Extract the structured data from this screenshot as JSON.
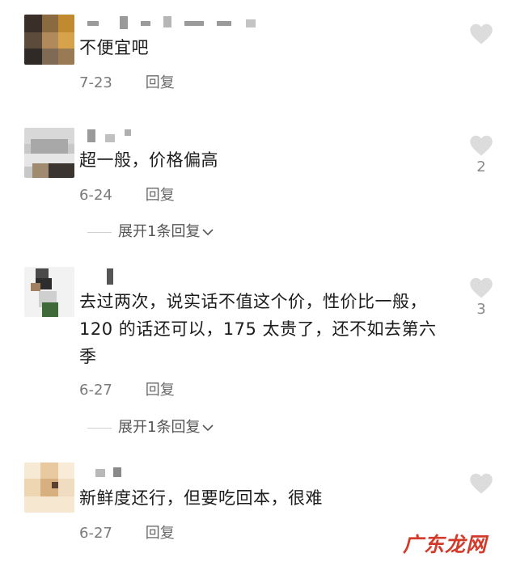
{
  "comments": [
    {
      "text": "不便宜吧",
      "date": "7-23",
      "reply_label": "回复",
      "likes": "",
      "expand_label": ""
    },
    {
      "text": "超一般，价格偏高",
      "date": "6-24",
      "reply_label": "回复",
      "likes": "2",
      "expand_label": "展开1条回复"
    },
    {
      "text": "去过两次，说实话不值这个价，性价比一般，120 的话还可以，175 太贵了，还不如去第六季",
      "date": "6-27",
      "reply_label": "回复",
      "likes": "3",
      "expand_label": "展开1条回复"
    },
    {
      "text": "新鲜度还行，但要吃回本，很难",
      "date": "6-27",
      "reply_label": "回复",
      "likes": "",
      "expand_label": ""
    }
  ],
  "watermark": "广东龙网",
  "icons": {
    "like": "heart-icon",
    "expand": "chevron-down-icon"
  },
  "colors": {
    "like_icon": "#dcdcdc",
    "watermark": "#d23a2a"
  }
}
